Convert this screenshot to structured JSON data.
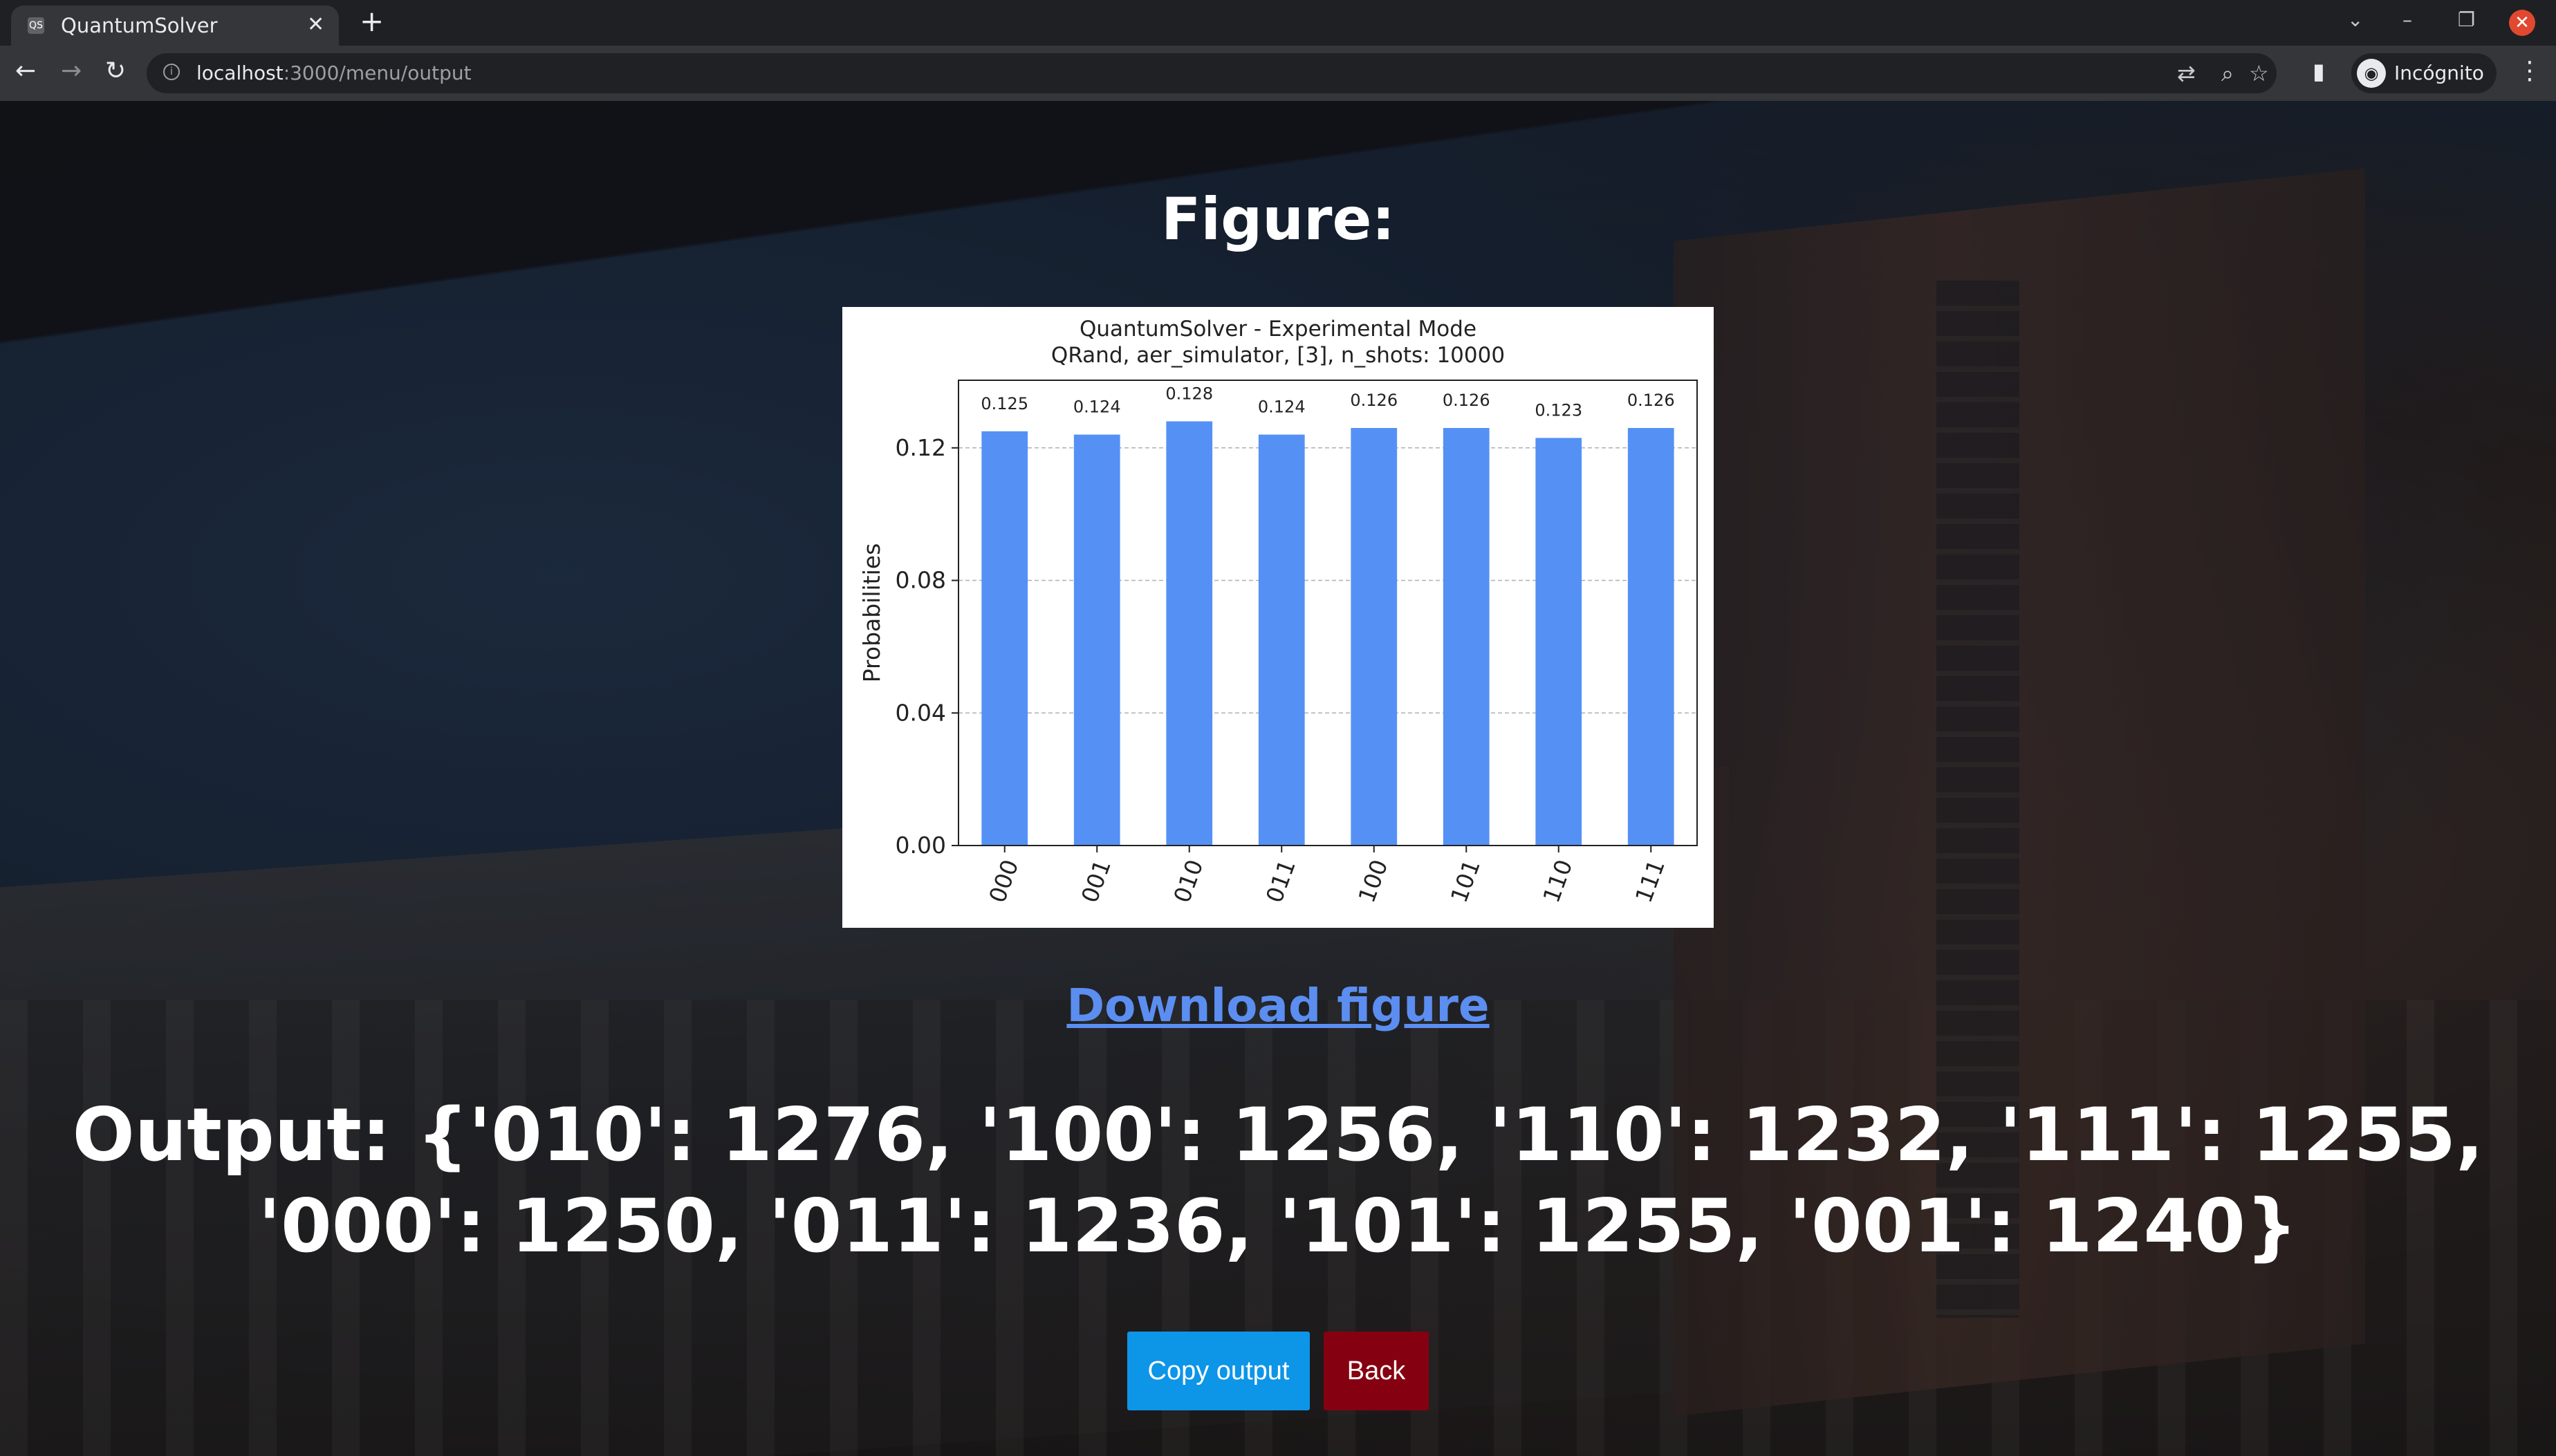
{
  "browser": {
    "tab_title": "QuantumSolver",
    "tab_favicon": "QS",
    "url_host": "localhost",
    "url_path": ":3000/menu/output",
    "profile_label": "Incógnito"
  },
  "page": {
    "figure_heading": "Figure:",
    "download_label": "Download figure",
    "output_text": "Output: {'010': 1276, '100': 1256, '110': 1232, '111': 1255, '000': 1250, '011': 1236, '101': 1255, '001': 1240}",
    "copy_button": "Copy output",
    "back_button": "Back"
  },
  "colors": {
    "bar": "#5591f5",
    "copy_button": "#0d95e8",
    "back_button": "#850010",
    "link": "#5b8ef0"
  },
  "chart_data": {
    "type": "bar",
    "title": "QuantumSolver - Experimental Mode",
    "subtitle": "QRand, aer_simulator, [3], n_shots: 10000",
    "ylabel": "Probabilities",
    "xlabel": "",
    "categories": [
      "000",
      "001",
      "010",
      "011",
      "100",
      "101",
      "110",
      "111"
    ],
    "values": [
      0.125,
      0.124,
      0.128,
      0.124,
      0.126,
      0.126,
      0.123,
      0.126
    ],
    "value_labels": [
      "0.125",
      "0.124",
      "0.128",
      "0.124",
      "0.126",
      "0.126",
      "0.123",
      "0.126"
    ],
    "ylim": [
      0,
      0.1404
    ],
    "yticks": [
      0.0,
      0.04,
      0.08,
      0.12
    ],
    "ytick_labels": [
      "0.00",
      "0.04",
      "0.08",
      "0.12"
    ],
    "grid": "horizontal-dashed"
  }
}
